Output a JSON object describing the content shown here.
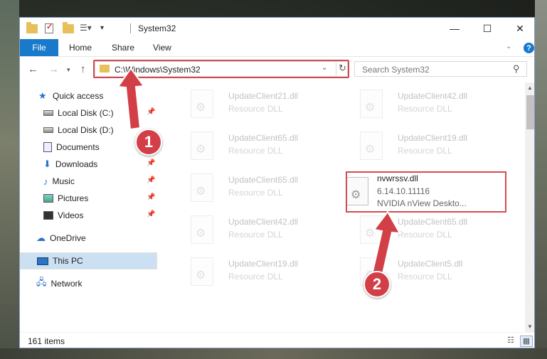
{
  "window": {
    "title": "System32"
  },
  "ribbon": {
    "tabs": [
      "File",
      "Home",
      "Share",
      "View"
    ]
  },
  "address": {
    "path": "C:\\Windows\\System32"
  },
  "search": {
    "placeholder": "Search System32"
  },
  "sidebar": {
    "items": [
      {
        "label": "Quick access",
        "icon": "star-icon",
        "pinned": false
      },
      {
        "label": "Local Disk (C:)",
        "icon": "drive-icon",
        "pinned": true
      },
      {
        "label": "Local Disk (D:)",
        "icon": "drive-icon",
        "pinned": false
      },
      {
        "label": "Documents",
        "icon": "documents-icon",
        "pinned": true
      },
      {
        "label": "Downloads",
        "icon": "download-icon",
        "pinned": true
      },
      {
        "label": "Music",
        "icon": "music-icon",
        "pinned": true
      },
      {
        "label": "Pictures",
        "icon": "pictures-icon",
        "pinned": true
      },
      {
        "label": "Videos",
        "icon": "videos-icon",
        "pinned": true
      },
      {
        "label": "OneDrive",
        "icon": "cloud-icon",
        "pinned": false
      },
      {
        "label": "This PC",
        "icon": "computer-icon",
        "pinned": false,
        "selected": true
      },
      {
        "label": "Network",
        "icon": "network-icon",
        "pinned": false
      }
    ]
  },
  "files": {
    "left_column": [
      {
        "name": "UpdateClient21.dll",
        "type": "Resource DLL"
      },
      {
        "name": "UpdateClient65.dll",
        "type": "Resource DLL"
      },
      {
        "name": "UpdateClient65.dll",
        "type": "Resource DLL"
      },
      {
        "name": "UpdateClient42.dll",
        "type": "Resource DLL"
      },
      {
        "name": "UpdateClient19.dll",
        "type": "Resource DLL"
      }
    ],
    "right_column": [
      {
        "name": "UpdateClient42.dll",
        "type": "Resource DLL"
      },
      {
        "name": "UpdateClient19.dll",
        "type": "Resource DLL"
      },
      {
        "name": "nvwrssv.dll",
        "version": "6.14.10.11116",
        "description": "NVIDIA nView Deskto...",
        "highlighted": true
      },
      {
        "name": "UpdateClient65.dll",
        "type": "Resource DLL"
      },
      {
        "name": "UpdateClient5.dll",
        "type": "Resource DLL"
      }
    ]
  },
  "status": {
    "count": "161 items"
  },
  "annotations": {
    "step1": "1",
    "step2": "2",
    "color": "#d23f47"
  }
}
